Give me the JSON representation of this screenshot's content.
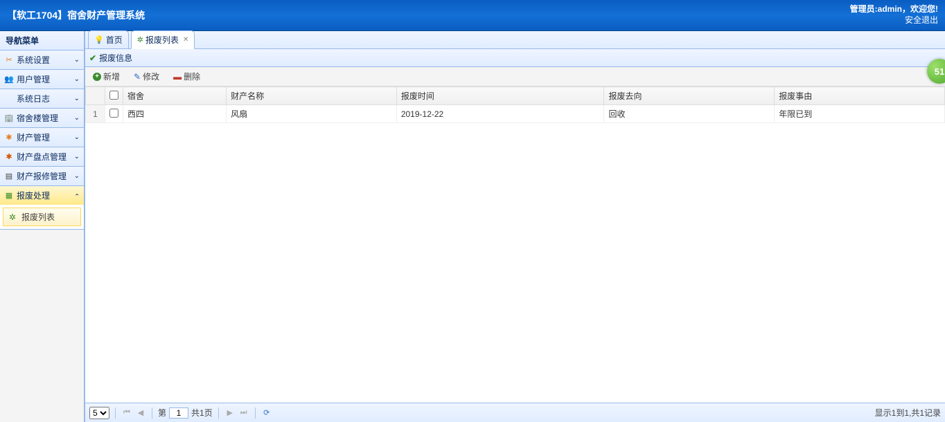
{
  "header": {
    "title": "【软工1704】宿舍财产管理系统",
    "admin_label": "管理员:admin",
    "welcome": "，欢迎您!",
    "logout": "安全退出"
  },
  "sidebar": {
    "title": "导航菜单",
    "items": [
      {
        "label": "系统设置",
        "icon": "✂",
        "icon_cls": "ic-orange"
      },
      {
        "label": "用户管理",
        "icon": "👥",
        "icon_cls": "ic-blue"
      },
      {
        "label": "系统日志",
        "icon": "",
        "icon_cls": "ic-gray"
      },
      {
        "label": "宿舍楼管理",
        "icon": "🏢",
        "icon_cls": "ic-gray"
      },
      {
        "label": "财产管理",
        "icon": "✱",
        "icon_cls": "ic-orange"
      },
      {
        "label": "财产盘点管理",
        "icon": "✱",
        "icon_cls": "ic-red"
      },
      {
        "label": "财产报修管理",
        "icon": "▤",
        "icon_cls": "ic-dark"
      },
      {
        "label": "报废处理",
        "icon": "▦",
        "icon_cls": "ic-green",
        "active": true,
        "children": [
          {
            "label": "报废列表",
            "icon": "✲"
          }
        ]
      }
    ]
  },
  "tabs": [
    {
      "label": "首页",
      "icon": "💡",
      "closable": false
    },
    {
      "label": "报废列表",
      "icon": "✲",
      "closable": true,
      "active": true
    }
  ],
  "panel": {
    "title": "报废信息"
  },
  "toolbar": {
    "add": "新增",
    "edit": "修改",
    "delete": "删除"
  },
  "grid": {
    "columns": [
      "宿舍",
      "财产名称",
      "报废时间",
      "报废去向",
      "报废事由"
    ],
    "rows": [
      {
        "num": "1",
        "cells": [
          "西四",
          "风扇",
          "2019-12-22",
          "回收",
          "年限已到"
        ]
      }
    ]
  },
  "pager": {
    "page_size": "5",
    "page_label_prefix": "第",
    "page": "1",
    "total_pages_label": "共1页",
    "info": "显示1到1,共1记录"
  },
  "badge": "51"
}
